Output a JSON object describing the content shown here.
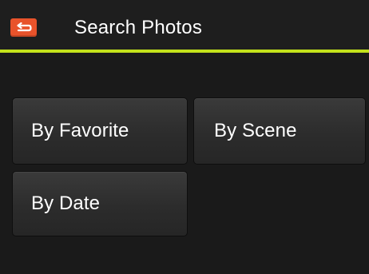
{
  "header": {
    "title": "Search Photos",
    "back_icon": "back-arrow-icon",
    "accent_color": "#c3e21b",
    "back_button_color": "#e8532b"
  },
  "options": {
    "favorite": "By Favorite",
    "scene": "By Scene",
    "date": "By Date"
  }
}
